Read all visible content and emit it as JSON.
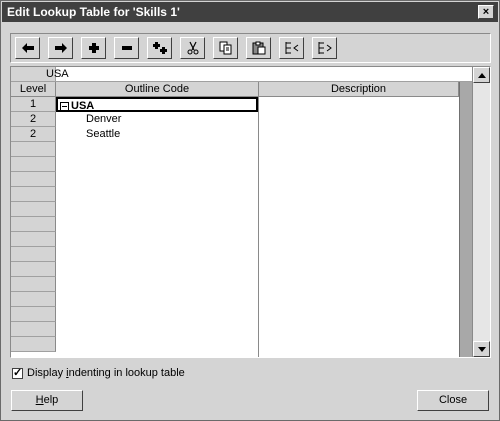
{
  "window": {
    "title": "Edit Lookup Table for 'Skills 1'",
    "close_glyph": "×"
  },
  "toolbar": {
    "buttons": [
      {
        "name": "outdent-icon"
      },
      {
        "name": "indent-icon"
      },
      {
        "name": "insert-row-icon"
      },
      {
        "name": "delete-row-icon"
      },
      {
        "name": "insert-subtask-icon"
      },
      {
        "name": "cut-icon"
      },
      {
        "name": "copy-icon"
      },
      {
        "name": "paste-icon"
      },
      {
        "name": "import-icon"
      },
      {
        "name": "export-icon"
      }
    ]
  },
  "entry_bar": {
    "value": "USA"
  },
  "table": {
    "columns": {
      "level": "Level",
      "outline_code": "Outline Code",
      "description": "Description"
    },
    "rows": [
      {
        "level": "1",
        "outline_code": "USA",
        "description": "",
        "expanded": true
      },
      {
        "level": "2",
        "outline_code": "Denver",
        "description": ""
      },
      {
        "level": "2",
        "outline_code": "Seattle",
        "description": ""
      }
    ]
  },
  "options": {
    "display_indenting_label_prefix": "Display ",
    "display_indenting_underlined": "i",
    "display_indenting_label_rest": "ndenting in lookup table",
    "display_indenting_checked": true
  },
  "buttons": {
    "help_prefix": "",
    "help_underlined": "H",
    "help_rest": "elp",
    "close": "Close"
  }
}
